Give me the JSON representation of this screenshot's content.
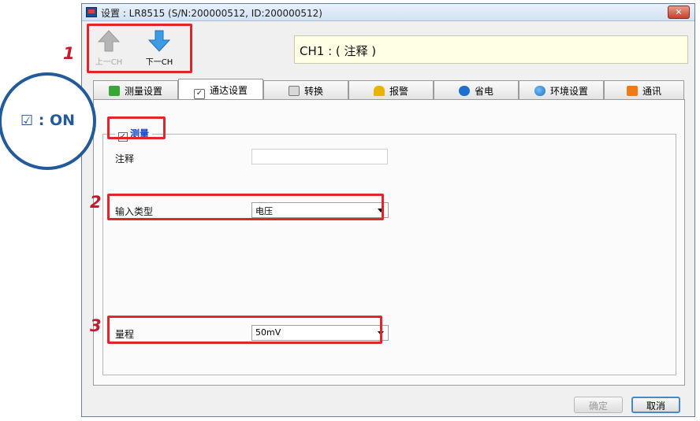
{
  "window": {
    "title": "设置 : LR8515 (S/N:200000512, ID:200000512)",
    "close": "✕"
  },
  "toolbar": {
    "prev_label": "上一CH",
    "next_label": "下一CH"
  },
  "channel_comment": "CH1 : ( 注释 )",
  "tabs": [
    {
      "label": "测量设置",
      "icon": "measure-icon",
      "color": "#3aa537"
    },
    {
      "label": "通达设置",
      "icon": "checkbox-icon",
      "color": "#4b86c8"
    },
    {
      "label": "转换",
      "icon": "calculator-icon",
      "color": "#777777"
    },
    {
      "label": "报警",
      "icon": "bell-icon",
      "color": "#e8b400"
    },
    {
      "label": "省电",
      "icon": "bluetooth-icon",
      "color": "#1e6fd0"
    },
    {
      "label": "环境设置",
      "icon": "globe-icon",
      "color": "#2c7fce"
    },
    {
      "label": "通讯",
      "icon": "rss-icon",
      "color": "#f07a16"
    }
  ],
  "active_tab": 1,
  "measure": {
    "label": "测量",
    "checked": true,
    "check_mark": "✓"
  },
  "fields": {
    "comment_label": "注释",
    "comment_value": "",
    "input_type_label": "输入类型",
    "input_type_value": "电压",
    "range_label": "量程",
    "range_value": "50mV"
  },
  "buttons": {
    "ok": "确定",
    "cancel": "取消"
  },
  "annotations": {
    "n1": "1",
    "n2": "2",
    "n3": "3",
    "bubble_symbol": "☑",
    "bubble_text": " : ON",
    "highlight_color": "#e0262d",
    "bubble_color": "#235a9a"
  }
}
